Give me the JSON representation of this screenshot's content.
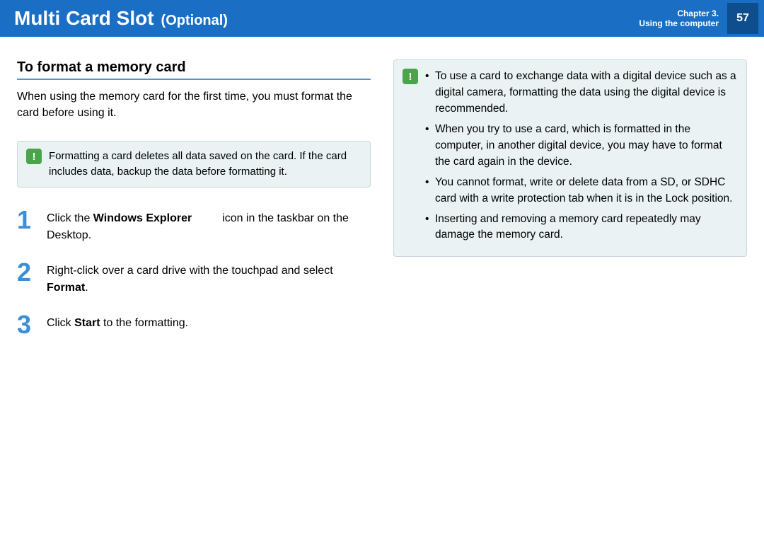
{
  "header": {
    "title": "Multi Card Slot",
    "subtitle": "(Optional)",
    "chapter_line1": "Chapter 3.",
    "chapter_line2": "Using the computer",
    "page": "57"
  },
  "left": {
    "section_title": "To format a memory card",
    "intro": "When using the memory card for the first time, you must format the card before using it.",
    "warning": "Formatting a card deletes all data saved on the card. If the card includes data, backup the data before formatting it.",
    "steps": {
      "s1": {
        "num": "1",
        "pre": "Click the ",
        "bold": "Windows Explorer",
        "mid": " ",
        "post": " icon in the taskbar on the Desktop."
      },
      "s2": {
        "num": "2",
        "pre": "Right-click over a card drive with the touchpad and select ",
        "bold": "Format",
        "post": "."
      },
      "s3": {
        "num": "3",
        "pre": "Click ",
        "bold": "Start",
        "post": " to the formatting."
      }
    }
  },
  "right": {
    "bullets": [
      "To use a card to exchange data with a digital device such as a digital camera, formatting the data using the digital device is recommended.",
      "When you try to use a card, which is formatted in the computer, in another digital device, you may have to format the card again in the device.",
      "You cannot format, write or delete data from a SD, or SDHC card with a write protection tab when it is in the Lock position.",
      "Inserting and removing a memory card repeatedly may damage the memory card."
    ]
  }
}
